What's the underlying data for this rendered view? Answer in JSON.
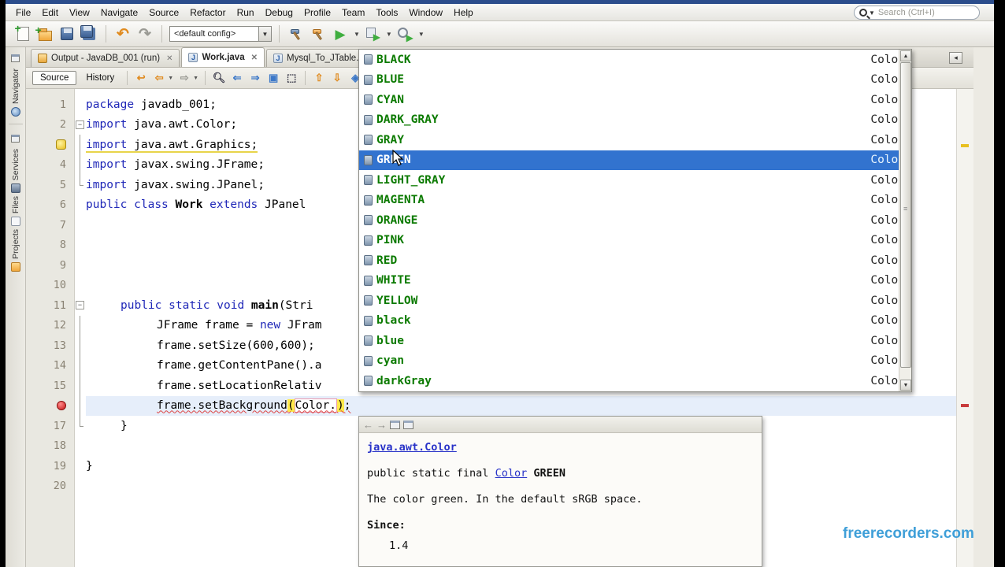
{
  "menu_bar": {
    "items": [
      "File",
      "Edit",
      "View",
      "Navigate",
      "Source",
      "Refactor",
      "Run",
      "Debug",
      "Profile",
      "Team",
      "Tools",
      "Window",
      "Help"
    ]
  },
  "search": {
    "placeholder": "Search (Ctrl+I)",
    "icon": "search-icon"
  },
  "toolbar": {
    "config_value": "<default config>",
    "icons": [
      "new-file-icon",
      "new-project-icon",
      "open-project-icon",
      "save-all-icon",
      "undo-icon",
      "redo-icon",
      "build-project-icon",
      "clean-build-icon",
      "run-project-icon",
      "debug-project-icon",
      "profile-project-icon"
    ]
  },
  "sidebar": {
    "tabs": [
      {
        "label": "Navigator",
        "icon": "navigator-icon"
      },
      {
        "label": "Services",
        "icon": "services-icon"
      },
      {
        "label": "Files",
        "icon": "files-icon"
      },
      {
        "label": "Projects",
        "icon": "projects-icon"
      }
    ]
  },
  "doc_tabs": [
    {
      "label": "Output - JavaDB_001 (run)",
      "icon": "output-icon",
      "close": "x",
      "active": false
    },
    {
      "label": "Work.java",
      "icon": "java-file-icon",
      "close": "x",
      "active": true
    },
    {
      "label": "Mysql_To_JTable.java",
      "icon": "java-file-icon",
      "close": "",
      "active": false
    }
  ],
  "tab_scroll_left": "◂",
  "editor_toolbar": {
    "source_label": "Source",
    "history_label": "History",
    "icons": [
      "last-edit-icon",
      "back-icon",
      "forward-icon",
      "find-selection-icon",
      "find-previous-icon",
      "find-next-icon",
      "toggle-highlight-icon",
      "select-occurrence-icon",
      "previous-bookmark-icon",
      "next-bookmark-icon",
      "toggle-bookmark-icon",
      "shift-left-icon"
    ]
  },
  "editor": {
    "lines": [
      {
        "num": "1",
        "gutter": "num",
        "fold": "",
        "indent": 0,
        "hl": false,
        "code": [
          [
            "package",
            "kw"
          ],
          [
            " javadb_001;",
            "pl"
          ]
        ]
      },
      {
        "num": "2",
        "gutter": "num",
        "fold": "minus",
        "indent": 0,
        "hl": false,
        "code": [
          [
            "import",
            "kw"
          ],
          [
            " java.awt.Color;",
            "pl"
          ]
        ]
      },
      {
        "num": "3",
        "gutter": "warn",
        "fold": "line",
        "indent": 0,
        "hl": false,
        "code": [
          [
            "import",
            "kw warnu"
          ],
          [
            " java.awt.Graphics;",
            "pl warnu"
          ]
        ]
      },
      {
        "num": "4",
        "gutter": "num",
        "fold": "line",
        "indent": 0,
        "hl": false,
        "code": [
          [
            "import",
            "kw"
          ],
          [
            " javax.swing.JFrame;",
            "pl"
          ]
        ]
      },
      {
        "num": "5",
        "gutter": "num",
        "fold": "end",
        "indent": 0,
        "hl": false,
        "code": [
          [
            "import",
            "kw"
          ],
          [
            " javax.swing.JPanel;",
            "pl"
          ]
        ]
      },
      {
        "num": "6",
        "gutter": "num",
        "fold": "",
        "indent": 0,
        "hl": false,
        "code": [
          [
            "public",
            "kw"
          ],
          [
            " ",
            "pl"
          ],
          [
            "class",
            "kw"
          ],
          [
            " ",
            "pl"
          ],
          [
            "Work",
            "bold"
          ],
          [
            " ",
            "pl"
          ],
          [
            "extends",
            "kw"
          ],
          [
            " JPanel",
            "pl"
          ]
        ]
      },
      {
        "num": "7",
        "gutter": "num",
        "fold": "",
        "indent": 0,
        "hl": false,
        "code": []
      },
      {
        "num": "8",
        "gutter": "num",
        "fold": "",
        "indent": 0,
        "hl": false,
        "code": []
      },
      {
        "num": "9",
        "gutter": "num",
        "fold": "",
        "indent": 0,
        "hl": false,
        "code": []
      },
      {
        "num": "10",
        "gutter": "num",
        "fold": "",
        "indent": 0,
        "hl": false,
        "code": []
      },
      {
        "num": "11",
        "gutter": "num",
        "fold": "minus",
        "indent": 44,
        "hl": false,
        "code": [
          [
            "public",
            "kw"
          ],
          [
            " ",
            "pl"
          ],
          [
            "static",
            "kw"
          ],
          [
            " ",
            "pl"
          ],
          [
            "void",
            "kw"
          ],
          [
            " ",
            "pl"
          ],
          [
            "main",
            "bold"
          ],
          [
            "(Stri",
            "pl"
          ]
        ]
      },
      {
        "num": "12",
        "gutter": "num",
        "fold": "line",
        "indent": 90,
        "hl": false,
        "code": [
          [
            "JFrame frame = ",
            "pl"
          ],
          [
            "new",
            "kw"
          ],
          [
            " JFram",
            "pl"
          ]
        ]
      },
      {
        "num": "13",
        "gutter": "num",
        "fold": "line",
        "indent": 90,
        "hl": false,
        "code": [
          [
            "frame.setSize(600,600);",
            "pl"
          ]
        ]
      },
      {
        "num": "14",
        "gutter": "num",
        "fold": "line",
        "indent": 90,
        "hl": false,
        "code": [
          [
            "frame.getContentPane().a",
            "pl"
          ]
        ]
      },
      {
        "num": "15",
        "gutter": "num",
        "fold": "line",
        "indent": 90,
        "hl": false,
        "code": [
          [
            "frame.setLocationRelativ",
            "pl"
          ]
        ]
      },
      {
        "num": "16",
        "gutter": "break",
        "fold": "line",
        "indent": 90,
        "hl": true,
        "code": [
          [
            "frame.setBackground",
            "pl erru"
          ],
          [
            "(",
            "hlparen erru"
          ],
          [
            "Color.",
            "pl erru editbox"
          ],
          [
            ")",
            "hlparen erru"
          ],
          [
            ";",
            "pl erru"
          ]
        ]
      },
      {
        "num": "17",
        "gutter": "num",
        "fold": "end",
        "indent": 44,
        "hl": false,
        "code": [
          [
            "}",
            "pl"
          ]
        ]
      },
      {
        "num": "18",
        "gutter": "num",
        "fold": "",
        "indent": 0,
        "hl": false,
        "code": []
      },
      {
        "num": "19",
        "gutter": "num",
        "fold": "",
        "indent": 0,
        "hl": false,
        "code": [
          [
            "}",
            "pl"
          ]
        ]
      },
      {
        "num": "20",
        "gutter": "num",
        "fold": "",
        "indent": 0,
        "hl": false,
        "code": []
      }
    ]
  },
  "completion": {
    "selected_index": 5,
    "item_icon": "static-field-icon",
    "items": [
      {
        "name": "BLACK",
        "type": "Color"
      },
      {
        "name": "BLUE",
        "type": "Color"
      },
      {
        "name": "CYAN",
        "type": "Color"
      },
      {
        "name": "DARK_GRAY",
        "type": "Color"
      },
      {
        "name": "GRAY",
        "type": "Color"
      },
      {
        "name": "GREEN",
        "type": "Color"
      },
      {
        "name": "LIGHT_GRAY",
        "type": "Color"
      },
      {
        "name": "MAGENTA",
        "type": "Color"
      },
      {
        "name": "ORANGE",
        "type": "Color"
      },
      {
        "name": "PINK",
        "type": "Color"
      },
      {
        "name": "RED",
        "type": "Color"
      },
      {
        "name": "WHITE",
        "type": "Color"
      },
      {
        "name": "YELLOW",
        "type": "Color"
      },
      {
        "name": "black",
        "type": "Color"
      },
      {
        "name": "blue",
        "type": "Color"
      },
      {
        "name": "cyan",
        "type": "Color"
      },
      {
        "name": "darkGray",
        "type": "Color"
      }
    ]
  },
  "javadoc": {
    "icons": [
      "back-icon",
      "forward-icon",
      "show-external-icon",
      "open-browser-icon"
    ],
    "back_glyph": "⬅",
    "forward_glyph": "➡",
    "class_link": "java.awt.Color",
    "sig_prefix": "public static final ",
    "sig_type_link": "Color",
    "sig_name": " GREEN",
    "description": "The color green. In the default sRGB space.",
    "since_label": "Since:",
    "since_value": "1.4"
  },
  "colors": {
    "selection_blue": "#3273cf",
    "completion_green": "#0b7a00",
    "keyword_blue": "#2028b8",
    "breakpoint_red": "#c81818",
    "paren_highlight": "#ffe94a",
    "link_blue": "#2832c8",
    "watermark_blue": "#3f9fd8"
  },
  "watermark": "freerecorders.com"
}
